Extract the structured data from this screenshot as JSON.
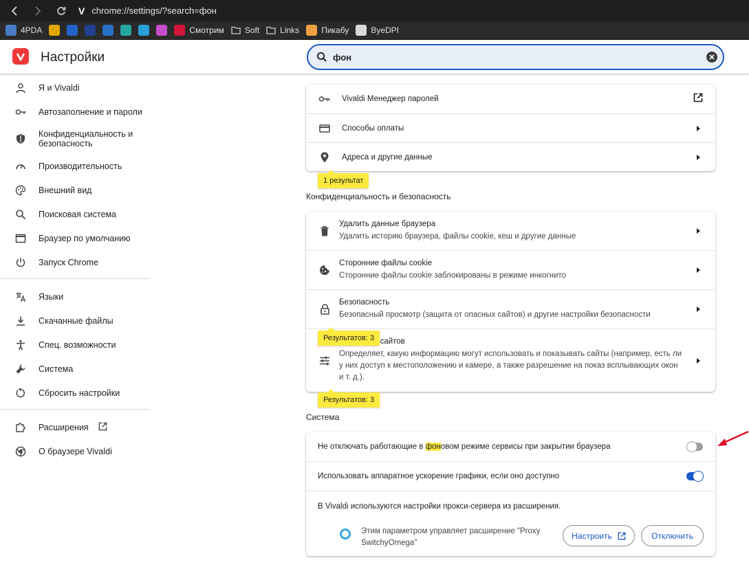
{
  "browser": {
    "url": "chrome://settings/?search=фон",
    "logo_letter": "V",
    "bookmarks": [
      {
        "label": "4PDA",
        "color": "#4a7cc6"
      },
      {
        "label": "",
        "color": "#e0a800"
      },
      {
        "label": "",
        "color": "#2262c6"
      },
      {
        "label": "",
        "color": "#1f3f8f"
      },
      {
        "label": "",
        "color": "#2a71c9"
      },
      {
        "label": "",
        "color": "#25a7a0"
      },
      {
        "label": "",
        "color": "#2aa0d8"
      },
      {
        "label": "",
        "color": "#c84fcc"
      },
      {
        "label": "Смотрим",
        "color": "#d4143a"
      },
      {
        "label": "Soft",
        "color": "folder"
      },
      {
        "label": "Links",
        "color": "folder"
      },
      {
        "label": "Пикабу",
        "color": "#f0a040"
      },
      {
        "label": "ByeDPI",
        "color": "#d8d8d8"
      }
    ]
  },
  "header": {
    "title": "Настройки",
    "search_value": "фон"
  },
  "sidebar": {
    "items": [
      {
        "label": "Я и Vivaldi",
        "icon": "person-icon"
      },
      {
        "label": "Автозаполнение и пароли",
        "icon": "key-icon"
      },
      {
        "label": "Конфиденциальность и безопасность",
        "icon": "shield-icon"
      },
      {
        "label": "Производительность",
        "icon": "speedometer-icon"
      },
      {
        "label": "Внешний вид",
        "icon": "palette-icon"
      },
      {
        "label": "Поисковая система",
        "icon": "search-icon"
      },
      {
        "label": "Браузер по умолчанию",
        "icon": "browser-window-icon"
      },
      {
        "label": "Запуск Chrome",
        "icon": "power-icon"
      },
      {
        "label": "Языки",
        "icon": "translate-icon"
      },
      {
        "label": "Скачанные файлы",
        "icon": "download-icon"
      },
      {
        "label": "Спец. возможности",
        "icon": "accessibility-icon"
      },
      {
        "label": "Система",
        "icon": "wrench-icon"
      },
      {
        "label": "Сбросить настройки",
        "icon": "reset-icon"
      },
      {
        "label": "Расширения",
        "icon": "puzzle-icon"
      },
      {
        "label": "О браузере Vivaldi",
        "icon": "chrome-icon"
      }
    ]
  },
  "autofill_card": {
    "rows": [
      {
        "label": "Vivaldi Менеджер паролей",
        "icon": "key-icon"
      },
      {
        "label": "Способы оплаты",
        "icon": "credit-card-icon"
      },
      {
        "label": "Адреса и другие данные",
        "icon": "location-pin-icon"
      }
    ],
    "badge": "1 результат"
  },
  "privacy": {
    "title": "Конфиденциальность и безопасность",
    "rows": [
      {
        "label": "Удалить данные браузера",
        "sub": "Удалить историю браузера, файлы cookie, кеш и другие данные",
        "icon": "trash-icon"
      },
      {
        "label": "Сторонние файлы cookie",
        "sub": "Сторонние файлы cookie заблокированы в режиме инкогнито",
        "icon": "cookie-icon"
      },
      {
        "label": "Безопасность",
        "sub": "Безопасный просмотр (защита от опасных сайтов) и другие настройки безопасности",
        "icon": "lock-icon"
      },
      {
        "label": "Настройки сайтов",
        "sub": "Определяет, какую информацию могут использовать и показывать сайты (например, есть ли у них доступ к местоположению и камере, а также разрешение на показ всплывающих окон и т. д.).",
        "icon": "sliders-icon"
      }
    ],
    "badge1": "Результатов: 3",
    "badge2": "Результатов: 3"
  },
  "system": {
    "title": "Система",
    "bg_before": "Не отключать работающие в ",
    "bg_highlight": "фон",
    "bg_after": "овом режиме сервисы при закрытии браузера",
    "bg_enabled": false,
    "hw_label": "Использовать аппаратное ускорение графики, если оно доступно",
    "hw_enabled": true,
    "proxy_label": "В Vivaldi используются настройки прокси-сервера из расширения.",
    "proxy_ext_line1": "Этим параметром управляет расширение \"Proxy",
    "proxy_ext_line2": "SwitchyOmega\"",
    "configure_btn": "Настроить",
    "disable_btn": "Отключить"
  },
  "colors": {
    "accent": "#1a58c9",
    "highlight": "#fcea3f",
    "annotation": "#e0102a"
  }
}
